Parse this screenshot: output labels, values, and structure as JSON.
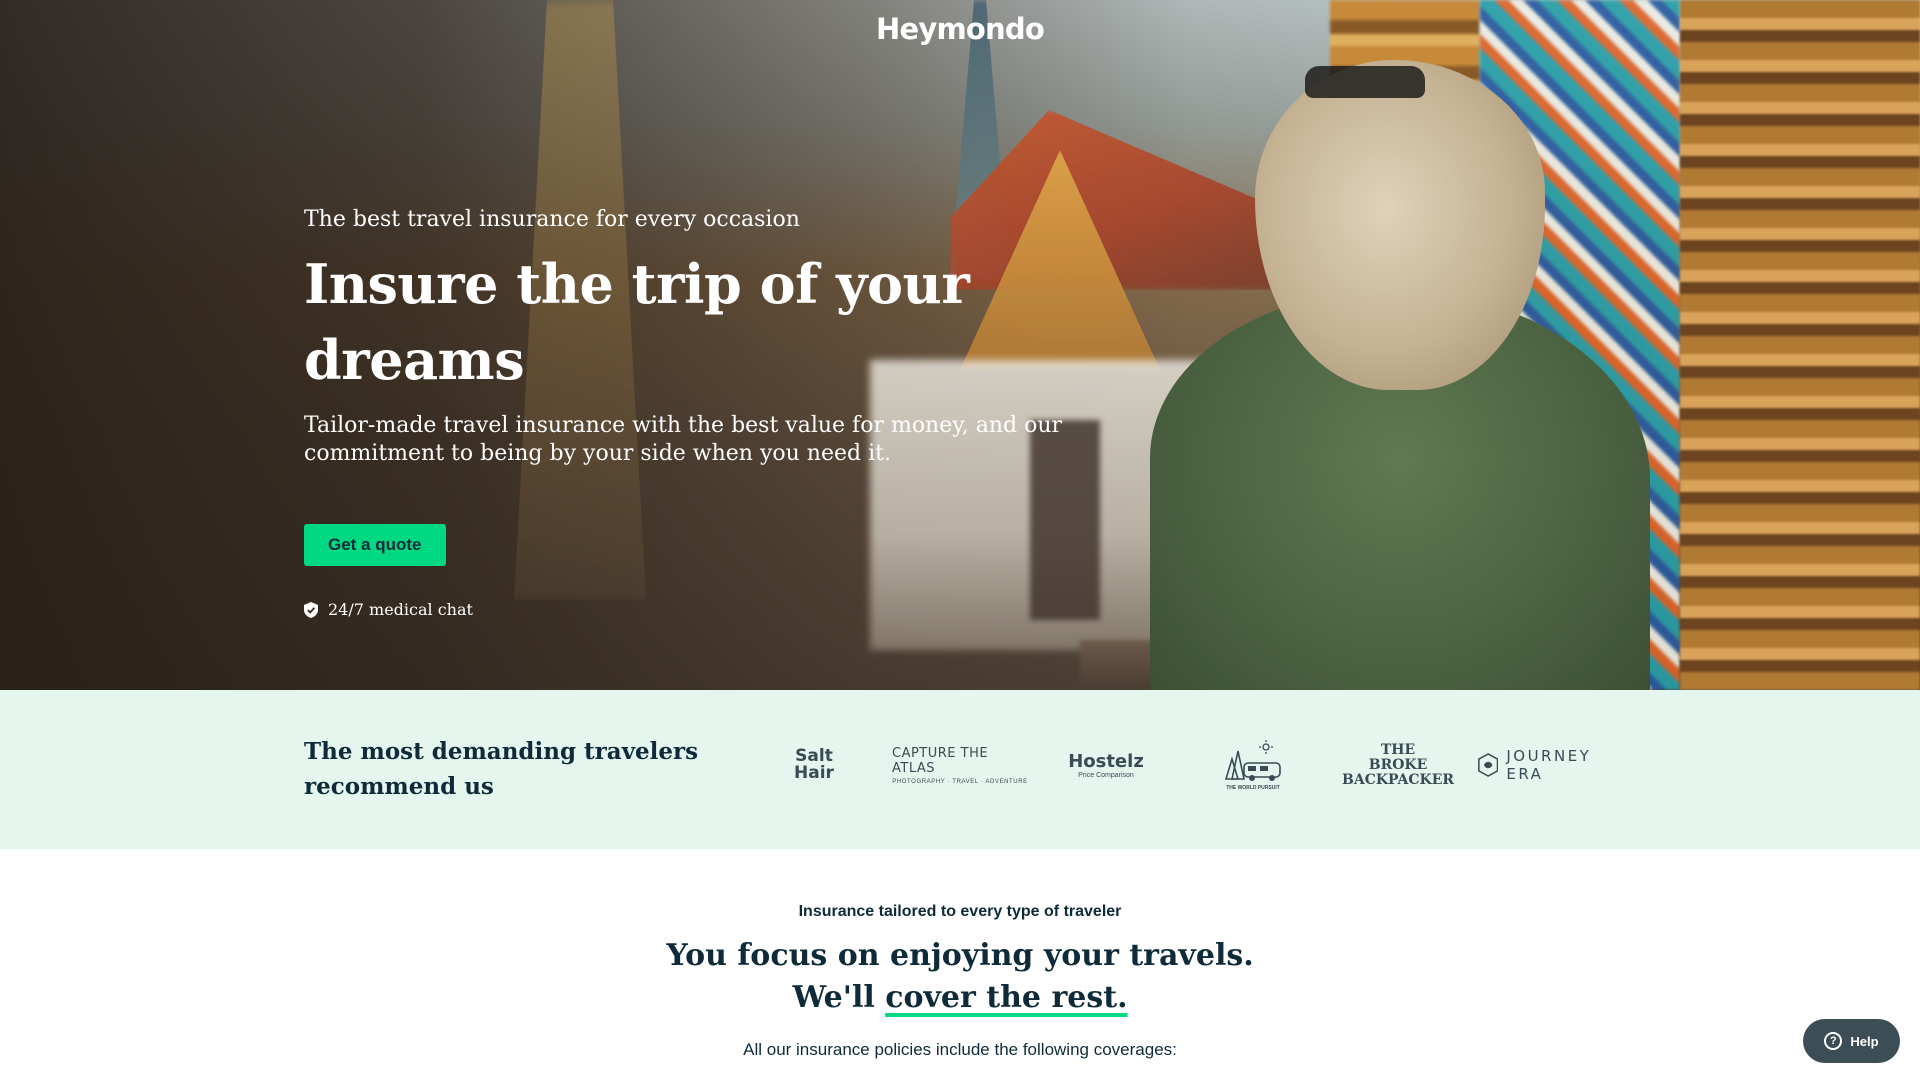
{
  "header": {
    "logo": "Heymondo"
  },
  "hero": {
    "eyebrow": "The best travel insurance for every occasion",
    "headline": "Insure the trip of your dreams",
    "subtext": "Tailor-made travel insurance with the best value for money, and our commitment to being by your side when you need it.",
    "cta_label": "Get a quote",
    "feature": {
      "icon": "shield-check-icon",
      "label": "24/7 medical chat"
    }
  },
  "recommend": {
    "title": "The most demanding travelers recommend us",
    "partners": [
      {
        "name": "salt-in-our-hair",
        "line1": "Salt",
        "line2": "Hair"
      },
      {
        "name": "capture-the-atlas",
        "line1": "CAPTURE THE ATLAS",
        "line2": "PHOTOGRAPHY · TRAVEL · ADVENTURE"
      },
      {
        "name": "hostelz",
        "line1": "Hostelz",
        "line2": "Price Comparison"
      },
      {
        "name": "the-world-pursuit",
        "line1": "THE WORLD PURSUIT"
      },
      {
        "name": "the-broke-backpacker",
        "line1": "THE BROKE",
        "line2": "BACKPACKER"
      },
      {
        "name": "journey-era",
        "line1": "JOURNEY ERA"
      }
    ]
  },
  "coverage": {
    "eyebrow": "Insurance tailored to every type of traveler",
    "title_line1": "You focus on enjoying your travels.",
    "title_line2_prefix": "We'll",
    "title_line2_highlight": "cover the rest.",
    "description": "All our insurance policies include the following coverages:"
  },
  "help": {
    "label": "Help",
    "icon": "question-circle-icon"
  },
  "colors": {
    "accent": "#00d982",
    "navy": "#0f2b3a",
    "band_bg": "#e4f6ee",
    "help_bg": "#3d4d56"
  }
}
